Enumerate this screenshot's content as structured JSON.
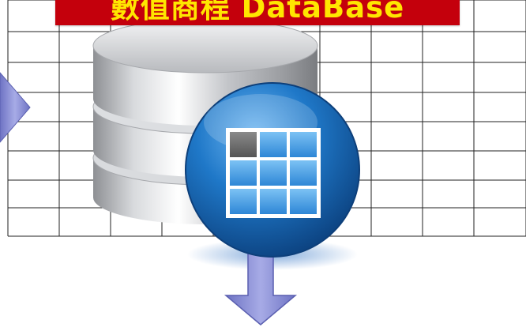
{
  "title": "數值商程 DataBase",
  "colors": {
    "banner_background": "#c4000c",
    "banner_text": "#ffe600",
    "grid_line": "#222222",
    "arrow": "#8a8fd6",
    "badge_blue": "#1f78c8",
    "cylinder_silver": "#c9cbcf"
  },
  "icons": [
    "database-cylinder-icon",
    "table-grid-icon",
    "down-arrow-icon",
    "right-arrow-icon"
  ]
}
